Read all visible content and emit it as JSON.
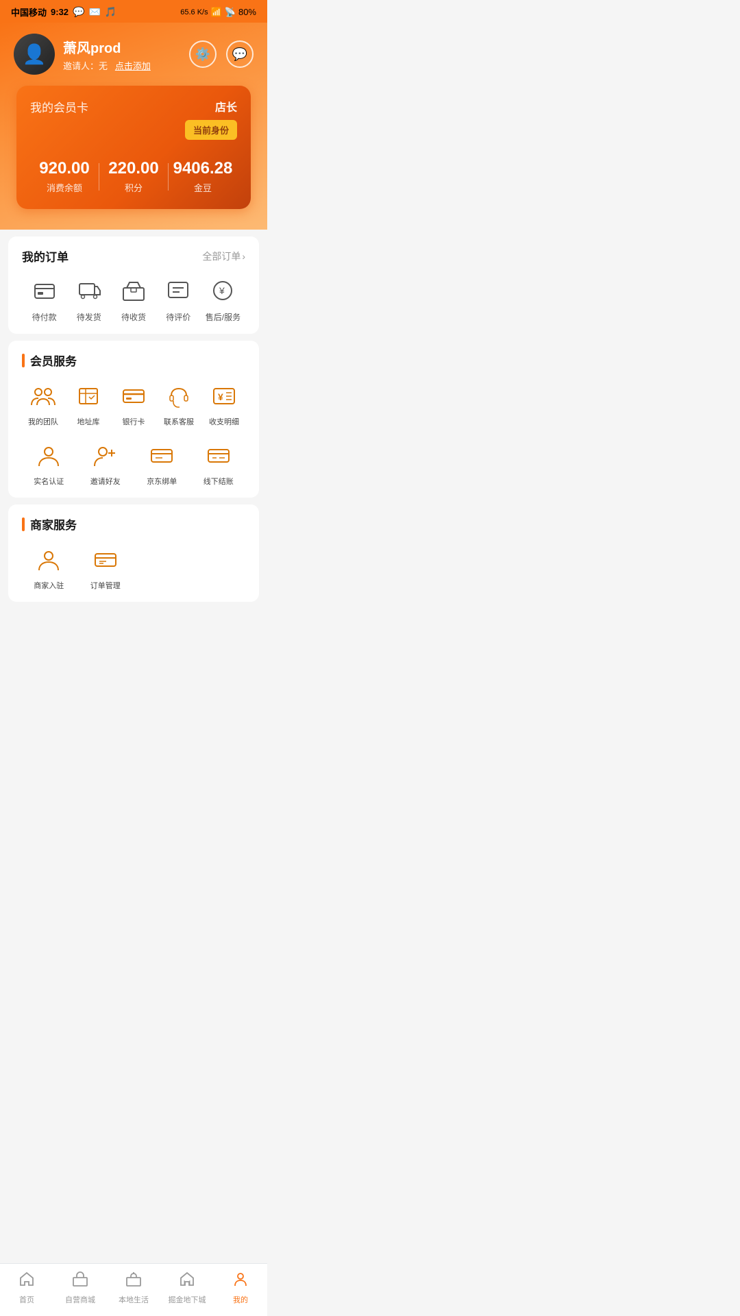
{
  "statusBar": {
    "carrier": "中国移动",
    "time": "9:32",
    "networkSpeed": "65.6 K/s",
    "battery": "80%"
  },
  "profile": {
    "username": "萧风prod",
    "inviteLabel": "邀请人：无",
    "inviteAction": "点击添加"
  },
  "memberCard": {
    "title": "我的会员卡",
    "storeManager": "店长",
    "identityBtn": "当前身份",
    "balance": "920.00",
    "balanceLabel": "消费余额",
    "points": "220.00",
    "pointsLabel": "积分",
    "goldBeans": "9406.28",
    "goldBeansLabel": "金豆"
  },
  "orders": {
    "title": "我的订单",
    "allOrders": "全部订单",
    "items": [
      {
        "label": "待付款"
      },
      {
        "label": "待发货"
      },
      {
        "label": "待收货"
      },
      {
        "label": "待评价"
      },
      {
        "label": "售后/服务"
      }
    ]
  },
  "memberServices": {
    "sectionTitle": "会员服务",
    "row1": [
      {
        "label": "我的团队"
      },
      {
        "label": "地址库"
      },
      {
        "label": "银行卡"
      },
      {
        "label": "联系客服"
      },
      {
        "label": "收支明细"
      }
    ],
    "row2": [
      {
        "label": "实名认证"
      },
      {
        "label": "邀请好友"
      },
      {
        "label": "京东绑单"
      },
      {
        "label": "线下结账"
      }
    ]
  },
  "merchantServices": {
    "sectionTitle": "商家服务",
    "items": [
      {
        "label": "商家入驻"
      },
      {
        "label": "订单管理"
      }
    ]
  },
  "bottomNav": {
    "items": [
      {
        "label": "首页",
        "active": false
      },
      {
        "label": "自营商城",
        "active": false
      },
      {
        "label": "本地生活",
        "active": false
      },
      {
        "label": "掘金地下城",
        "active": false
      },
      {
        "label": "我的",
        "active": true
      }
    ]
  }
}
